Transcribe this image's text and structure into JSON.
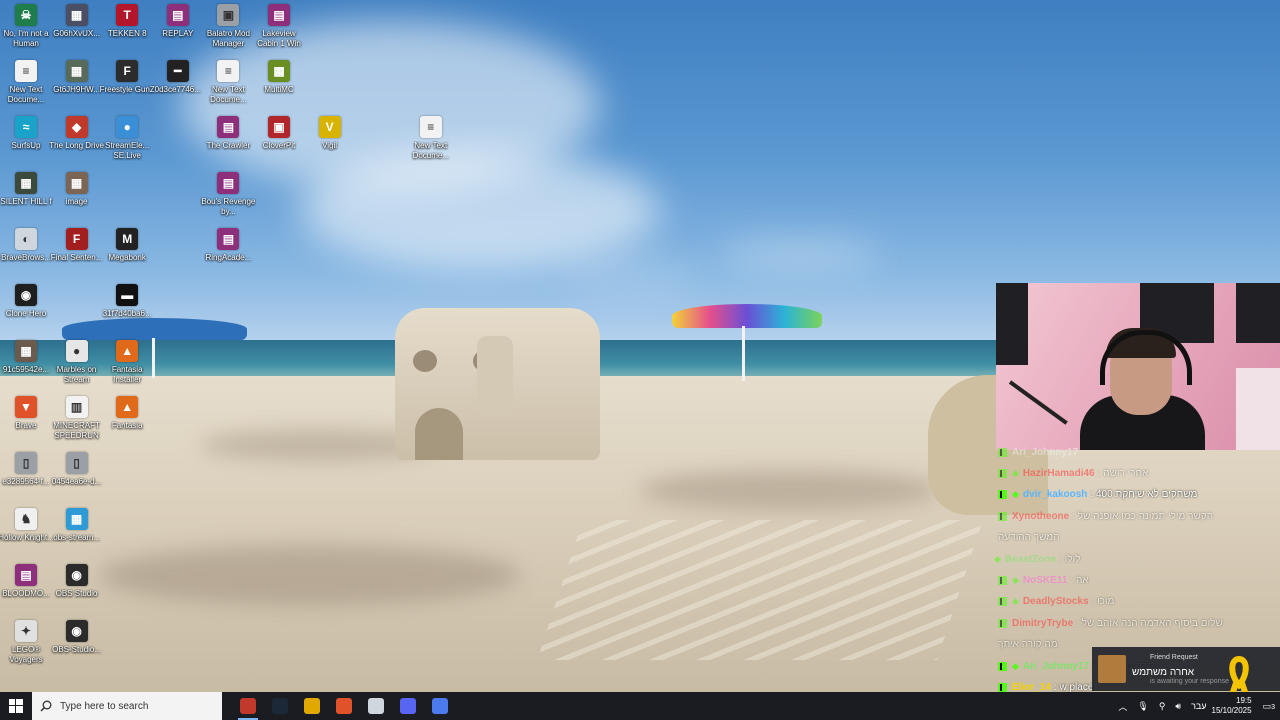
{
  "desktop_icons": [
    {
      "label": "No, I'm not a Human",
      "color": "#1e7d4a",
      "glyph": "☠"
    },
    {
      "label": "G06hXvUX...",
      "color": "#4a4f63",
      "glyph": "▦"
    },
    {
      "label": "TEKKEN 8",
      "color": "#b3162a",
      "glyph": "T"
    },
    {
      "label": "REPLAY",
      "color": "#8e2f7c",
      "glyph": "▤"
    },
    {
      "label": "Balatro Mod Manager",
      "color": "#9aa0a6",
      "glyph": "▣"
    },
    {
      "label": "Lakeview Cabin 1 Win",
      "color": "#8e2f7c",
      "glyph": "▤"
    },
    {
      "label": "New Text Docume...",
      "color": "#f2f2f2",
      "glyph": "≡"
    },
    {
      "label": "Gt6JH9HW...",
      "color": "#586a5a",
      "glyph": "▦"
    },
    {
      "label": "Freestyle GunZ",
      "color": "#2c2c2c",
      "glyph": "F"
    },
    {
      "label": "0d3ce7746...",
      "color": "#222222",
      "glyph": "━"
    },
    {
      "label": "New Text Docume...",
      "color": "#f2f2f2",
      "glyph": "≡"
    },
    {
      "label": "MultiMC",
      "color": "#6b8e23",
      "glyph": "▩"
    },
    {
      "label": "SurfsUp",
      "color": "#1aa3c8",
      "glyph": "≈"
    },
    {
      "label": "The Long Drive",
      "color": "#c0392b",
      "glyph": "◆"
    },
    {
      "label": "StreamEle... SE.Live",
      "color": "#3a8fd6",
      "glyph": "●"
    },
    {
      "label": "The Crawler",
      "color": "#8e2f7c",
      "glyph": "▤"
    },
    {
      "label": "CloverPit",
      "color": "#b0262a",
      "glyph": "▣"
    },
    {
      "label": "Vigil",
      "color": "#d8b400",
      "glyph": "V"
    },
    {
      "label": "New Text Docume...",
      "color": "#f2f2f2",
      "glyph": "≡"
    },
    {
      "label": "SILENT HILL f",
      "color": "#3b4a3c",
      "glyph": "▦"
    },
    {
      "label": "image",
      "color": "#7b6655",
      "glyph": "▦"
    },
    {
      "label": "Bou's Revenge by...",
      "color": "#8e2f7c",
      "glyph": "▤"
    },
    {
      "label": "BraveBrows...",
      "color": "#cfd6de",
      "glyph": "◐"
    },
    {
      "label": "Final Senten...",
      "color": "#a31f1f",
      "glyph": "F"
    },
    {
      "label": "Megabonk",
      "color": "#222222",
      "glyph": "M"
    },
    {
      "label": "RingAcade...",
      "color": "#8e2f7c",
      "glyph": "▤"
    },
    {
      "label": "Clone Hero",
      "color": "#1f1f1f",
      "glyph": "◉"
    },
    {
      "label": "31f7d40ba6...",
      "color": "#111111",
      "glyph": "▬"
    },
    {
      "label": "91c59542e...",
      "color": "#6b5a4e",
      "glyph": "▦"
    },
    {
      "label": "Marbles on Stream",
      "color": "#e6e6e6",
      "glyph": "●"
    },
    {
      "label": "Fantasia Installer",
      "color": "#e06a1a",
      "glyph": "▲"
    },
    {
      "label": "Brave",
      "color": "#e0532a",
      "glyph": "▼"
    },
    {
      "label": "MINECRAFT SPEEDRUN",
      "color": "#f2f2f2",
      "glyph": "▥"
    },
    {
      "label": "Fantasia",
      "color": "#e06a1a",
      "glyph": "▲"
    },
    {
      "label": "e3289564-f...",
      "color": "#9aa0a6",
      "glyph": "▯"
    },
    {
      "label": "0454ea6e-d...",
      "color": "#9aa0a6",
      "glyph": "▯"
    },
    {
      "label": "Hollow Knight...",
      "color": "#f0f0f0",
      "glyph": "♞"
    },
    {
      "label": "obs-stream...",
      "color": "#2f9bd6",
      "glyph": "▦"
    },
    {
      "label": "BLOODMO...",
      "color": "#8e2f7c",
      "glyph": "▤"
    },
    {
      "label": "OBS Studio",
      "color": "#2b2b2b",
      "glyph": "◉"
    },
    {
      "label": "LEGO® Voyagers",
      "color": "#e0e0e0",
      "glyph": "✦"
    },
    {
      "label": "OBS-Studio...",
      "color": "#2b2b2b",
      "glyph": "◉"
    }
  ],
  "chat": {
    "messages": [
      {
        "user": "Ari_Johnny17",
        "user_color": "#f0f0f0",
        "text": "",
        "badges": [
          "kick"
        ],
        "dim": true
      },
      {
        "user": "HazirHamadi46",
        "user_color": "#ff3b3b",
        "text": ": אחרי רושה",
        "badges": [
          "kick",
          "diamond"
        ],
        "dim": true
      },
      {
        "user": "dvir_kakoosh",
        "user_color": "#59b6ff",
        "text": ": משחקים לא שיחקת 400",
        "badges": [
          "kick",
          "diamond"
        ],
        "dim": false
      },
      {
        "user": "Xynotheone",
        "user_color": "#ff3b3b",
        "text": ": הקשר מילי תמונה כמו אופנה של",
        "badges": [
          "kick"
        ],
        "dim": true
      },
      {
        "user": "",
        "user_color": "#ffffff",
        "text": "המשך ההודעה",
        "badges": [],
        "dim": true
      },
      {
        "user": "BeastZone",
        "user_color": "#7fe36a",
        "text": ": לולו",
        "badges": [
          "diamond"
        ],
        "dim": true
      },
      {
        "user": "NoSKE11",
        "user_color": "#ff6bd6",
        "text": ": אה",
        "badges": [
          "kick",
          "diamond"
        ],
        "dim": true
      },
      {
        "user": "DeadlyStocks",
        "user_color": "#ff3b3b",
        "text": ": מוכו",
        "badges": [
          "kick",
          "diamond"
        ],
        "dim": true
      },
      {
        "user": "DimitryTrybe",
        "user_color": "#ff3b3b",
        "text": ": שלום ביסוף האדמה הנה אוהב של",
        "badges": [
          "kick"
        ],
        "dim": true
      },
      {
        "user": "",
        "user_color": "#ffffff",
        "text": "מה קורה איתך",
        "badges": [],
        "dim": true
      },
      {
        "user": "Ari_Johnny17",
        "user_color": "#7fe36a",
        "text": ": אחרה משתמש",
        "badges": [
          "kick",
          "diamond"
        ],
        "dim": false
      },
      {
        "user": "Elior_14",
        "user_color": "#f5d100",
        "text": ": w place",
        "badges": [
          "kick"
        ],
        "dim": false
      }
    ]
  },
  "toast": {
    "title": "Friend Request",
    "name": "אחרה משתמש",
    "subtitle": "is awaiting your response"
  },
  "taskbar": {
    "search_placeholder": "Type here to search",
    "apps": [
      {
        "name": "obs",
        "color": "#c0392b",
        "active": true
      },
      {
        "name": "steam",
        "color": "#1b2838",
        "active": false
      },
      {
        "name": "files",
        "color": "#e0a800",
        "active": false
      },
      {
        "name": "brave",
        "color": "#e0532a",
        "active": false
      },
      {
        "name": "shield",
        "color": "#cfd6de",
        "active": false
      },
      {
        "name": "discord",
        "color": "#5865f2",
        "active": false
      },
      {
        "name": "app",
        "color": "#4b7bec",
        "active": false
      }
    ],
    "language": "עבר",
    "time": "19:5",
    "date": "15/10/2025",
    "notifications": "3"
  }
}
